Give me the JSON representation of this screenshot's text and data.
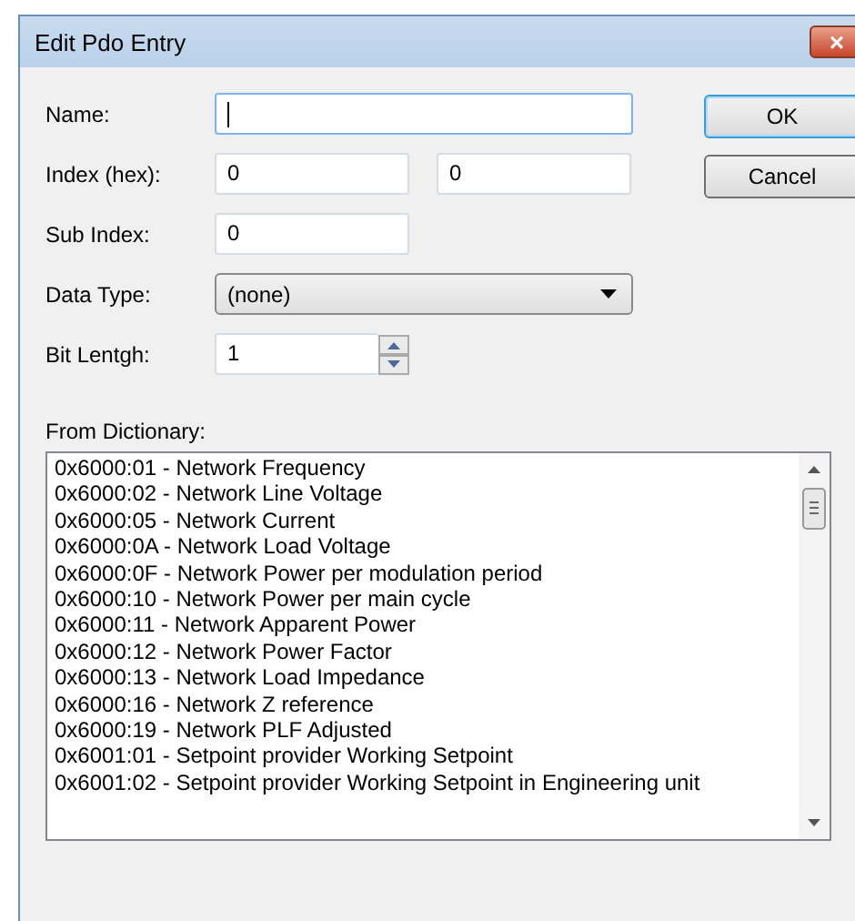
{
  "window": {
    "title": "Edit Pdo Entry",
    "close": "×"
  },
  "fields": [
    {
      "label": "Name:",
      "kind": "text",
      "focused": true
    },
    {
      "label": "Index (hex):",
      "kind": "pair",
      "values": [
        "0",
        "0"
      ],
      "focused": false
    },
    {
      "label": "Sub Index:",
      "kind": "short",
      "values": [
        "0"
      ],
      "focused": false
    },
    {
      "label": "Data Type:",
      "kind": "dropdown",
      "values": [
        "(none)"
      ],
      "focused": false
    },
    {
      "label": "Bit Lentgh:",
      "kind": "spinner",
      "values": [
        "1"
      ],
      "focused": false
    }
  ],
  "buttons": [
    {
      "label": "OK",
      "default": true
    },
    {
      "label": "Cancel",
      "default": false
    }
  ],
  "dictionary": {
    "label": "From Dictionary:",
    "items": [
      "0x6000:01 - Network Frequency",
      "0x6000:02 - Network Line Voltage",
      "0x6000:05 - Network Current",
      "0x6000:0A - Network Load Voltage",
      "0x6000:0F - Network Power per modulation period",
      "0x6000:10 - Network Power per main cycle",
      "0x6000:11 - Network Apparent Power",
      "0x6000:12 - Network Power Factor",
      "0x6000:13 - Network Load Impedance",
      "0x6000:16 - Network Z reference",
      "0x6000:19 - Network PLF Adjusted",
      "0x6001:01 - Setpoint provider Working Setpoint",
      "0x6001:02 - Setpoint provider Working Setpoint in Engineering unit"
    ]
  }
}
